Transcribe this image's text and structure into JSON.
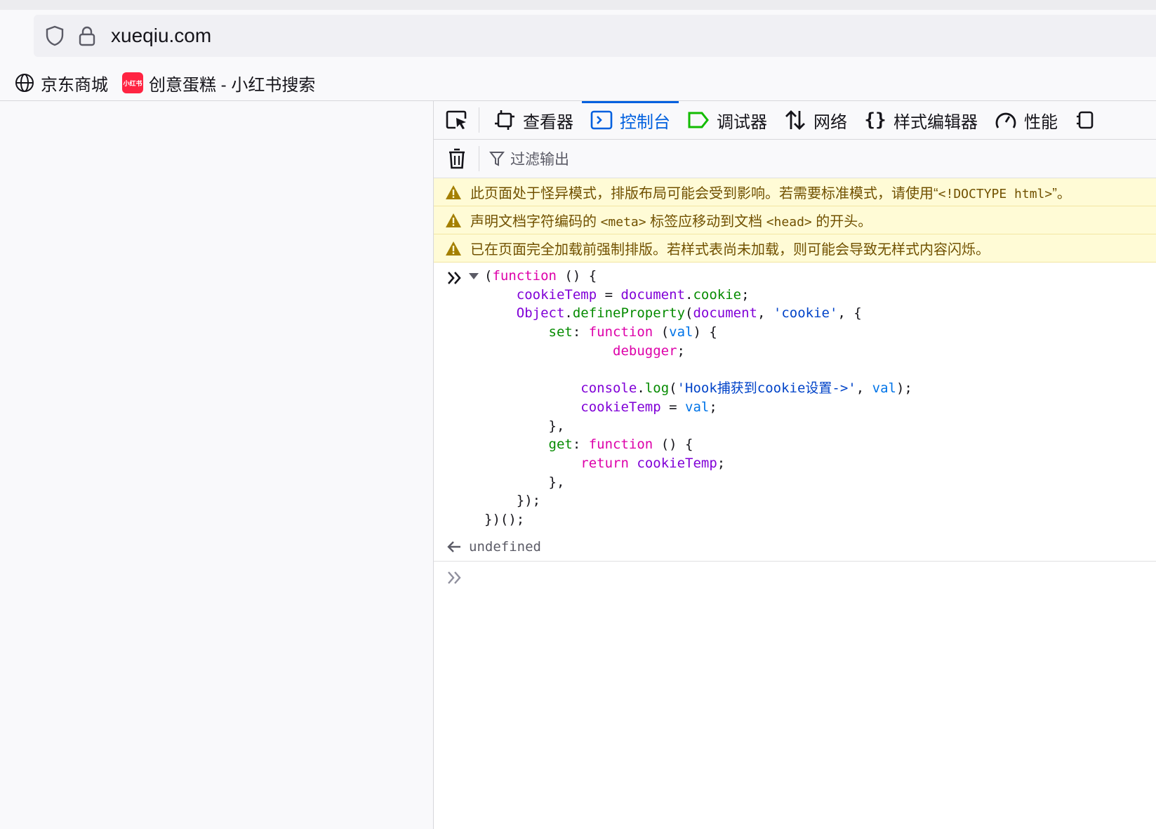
{
  "browser": {
    "url": "xueqiu.com",
    "bookmarks": [
      {
        "label": "京东商城",
        "icon": "globe-icon"
      },
      {
        "label": "创意蛋糕 - 小红书搜索",
        "icon": "xiaohongshu-logo",
        "icon_text": "小红书",
        "icon_color": "#ff2442"
      }
    ]
  },
  "devtools": {
    "tabs": [
      {
        "label": "查看器",
        "icon": "inspector-icon"
      },
      {
        "label": "控制台",
        "icon": "console-icon",
        "selected": true
      },
      {
        "label": "调试器",
        "icon": "debugger-icon"
      },
      {
        "label": "网络",
        "icon": "network-icon"
      },
      {
        "label": "样式编辑器",
        "icon": "style-editor-icon"
      },
      {
        "label": "性能",
        "icon": "performance-icon"
      }
    ],
    "accent_color": "#0060df",
    "filter_placeholder": "过滤输出",
    "warnings": [
      {
        "pre": "此页面处于怪异模式，排版布局可能会受到影响。若需要标准模式，请使用“",
        "code": "<!DOCTYPE html>",
        "post": "”。"
      },
      {
        "pre": "声明文档字符编码的 ",
        "code": "<meta>",
        "mid": " 标签应移动到文档 ",
        "code2": "<head>",
        "post": " 的开头。"
      },
      {
        "pre": "已在页面完全加载前强制排版。若样式表尚未加载，则可能会导致无样式内容闪烁。",
        "code": "",
        "post": ""
      }
    ],
    "warning_color": "#fffbd6",
    "result": "undefined"
  }
}
